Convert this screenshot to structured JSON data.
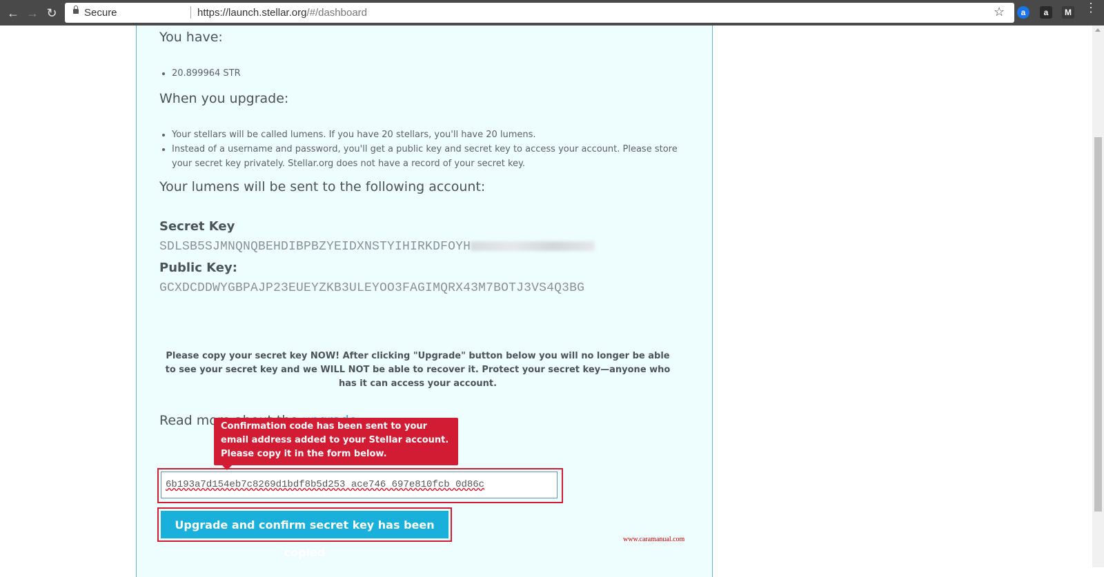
{
  "browser": {
    "secure_label": "Secure",
    "url_host": "https://launch.stellar.org",
    "url_path": "/#/dashboard",
    "back_icon": "arrow-left",
    "forward_icon": "arrow-right",
    "reload_icon": "reload",
    "bookmark_icon": "star",
    "extensions": [
      "a",
      "a",
      "M"
    ]
  },
  "content": {
    "you_have_heading": "You have:",
    "balance": "20.899964 STR",
    "upgrade_heading": "When you upgrade:",
    "upgrade_points": [
      "Your stellars will be called lumens. If you have 20 stellars, you'll have 20 lumens.",
      "Instead of a username and password, you'll get a public key and secret key to access your account. Please store your secret key privately. Stellar.org does not have a record of your secret key."
    ],
    "account_heading": "Your lumens will be sent to the following account:",
    "secret_key_label": "Secret Key",
    "secret_key_value": "SDLSB5SJMNQNQBEHDIBPBZYEIDXNSTYIHIRKDFOYH",
    "public_key_label": "Public Key:",
    "public_key_value": "GCXDCDDWYGBPAJP23EUEYZKB3ULEYOO3FAGIMQRX43M7BOTJ3VS4Q3BG",
    "warning": "Please copy your secret key NOW! After clicking \"Upgrade\" button below you will no longer be able to see your secret key and we WILL NOT be able to recover it. Protect your secret key—anyone who has it can access your account.",
    "read_more_prefix": "Read more about the ",
    "read_more_link": "upgrade",
    "read_more_suffix": ".",
    "tooltip": "Confirmation code has been sent to your email address added to your Stellar account. Please copy it in the form below.",
    "confirmation_code_value": "6b193a7d154eb7c8269d1bdf8b5d253  ace746   697e810fcb     0d86c",
    "upgrade_button": "Upgrade and confirm secret key has been copied",
    "watermark": "www.caramanual.com"
  },
  "colors": {
    "panel_bg": "#eefdfe",
    "accent": "#1ab0dc",
    "alert": "#d21c34",
    "link": "#26a6d1"
  }
}
